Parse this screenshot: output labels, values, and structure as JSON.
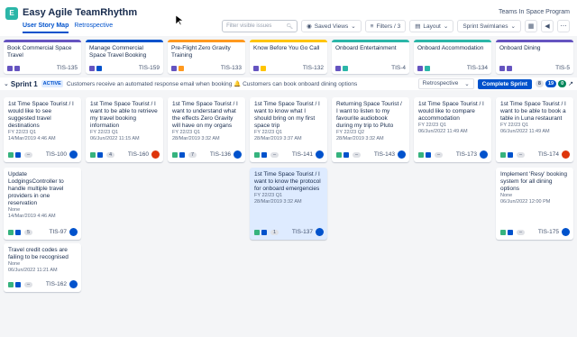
{
  "app": {
    "title": "Easy Agile TeamRhythm",
    "project": "Teams In Space Program"
  },
  "tabs": [
    {
      "label": "User Story Map"
    },
    {
      "label": "Retrospective"
    }
  ],
  "toolbar": {
    "search_placeholder": "Filter visible issues",
    "saved_views": "Saved Views",
    "filters": "Filters / 3",
    "layout": "Layout",
    "swimlanes": "Sprint Swimlanes"
  },
  "epics": [
    {
      "title": "Book Commercial Space Travel",
      "key": "TIS-135",
      "color": "#6554c0"
    },
    {
      "title": "Manage Commercial Space Travel Booking",
      "key": "TIS-159",
      "color": "#0052cc"
    },
    {
      "title": "Pre-Flight Zero Gravity Training",
      "key": "TIS-133",
      "color": "#ff991f"
    },
    {
      "title": "Know Before You Go Call",
      "key": "TIS-132",
      "color": "#ffc400"
    },
    {
      "title": "Onboard Entertainment",
      "key": "TIS-4",
      "color": "#2bb6a8"
    },
    {
      "title": "Onboard Accommodation",
      "key": "TIS-134",
      "color": "#2bb6a8"
    },
    {
      "title": "Onboard Dining",
      "key": "TIS-5",
      "color": "#6554c0"
    }
  ],
  "sprint": {
    "name": "Sprint 1",
    "badge": "ACTIVE",
    "goal": "Customers receive an automated response email when booking 🔔 Customers can book onboard dining options",
    "retro": "Retrospective",
    "complete": "Complete Sprint",
    "counts": [
      "8",
      "19",
      "0"
    ]
  },
  "cards": [
    {
      "col": 0,
      "row": 0,
      "title": "1st Time Space Tourist / I would like to see suggested travel destinations",
      "meta1": "FY 22/23 Q1",
      "meta2": "14/Mar/2019 4:46 AM",
      "est": "",
      "key": "TIS-100",
      "avatar": "blue"
    },
    {
      "col": 1,
      "row": 0,
      "title": "1st Time Space Tourist / I want to be able to retrieve my travel booking information",
      "meta1": "FY 22/23 Q1",
      "meta2": "06/Jun/2022 11:15 AM",
      "est": "4",
      "key": "TIS-160",
      "avatar": "red"
    },
    {
      "col": 2,
      "row": 0,
      "title": "1st Time Space Tourist / I want to understand what the effects Zero Gravity will have on my organs",
      "meta1": "FY 22/23 Q1",
      "meta2": "28/Mar/2019 3:32 AM",
      "est": "7",
      "key": "TIS-136",
      "avatar": "blue"
    },
    {
      "col": 3,
      "row": 0,
      "title": "1st Time Space Tourist / I want to know what I should bring on my first space trip",
      "meta1": "FY 22/23 Q1",
      "meta2": "28/Mar/2019 3:37 AM",
      "est": "",
      "key": "TIS-141",
      "avatar": "blue"
    },
    {
      "col": 4,
      "row": 0,
      "title": "Returning Space Tourist / I want to listen to my favourite audiobook during my trip to Pluto",
      "meta1": "FY 22/23 Q2",
      "meta2": "28/Mar/2019 3:32 AM",
      "est": "",
      "key": "TIS-143",
      "avatar": "blue"
    },
    {
      "col": 5,
      "row": 0,
      "title": "1st Time Space Tourist / I would like to compare accommodation",
      "meta1": "FY 22/23 Q1",
      "meta2": "06/Jun/2022 11:49 AM",
      "est": "",
      "key": "TIS-173",
      "avatar": "blue"
    },
    {
      "col": 6,
      "row": 0,
      "title": "1st Time Space Tourist / I want to be able to book a table in Luna restaurant",
      "meta1": "FY 22/23 Q1",
      "meta2": "06/Jun/2022 11:49 AM",
      "est": "",
      "key": "TIS-174",
      "avatar": "red"
    },
    {
      "col": 0,
      "row": 1,
      "title": "Update LodgingsController to handle multiple travel providers in one reservation",
      "meta1": "None",
      "meta2": "14/Mar/2019 4:46 AM",
      "est": "5",
      "key": "TIS-97",
      "avatar": "blue"
    },
    {
      "col": 3,
      "row": 1,
      "title": "1st Time Space Tourist / I want to know the protocol for onboard emergencies",
      "meta1": "FY 22/23 Q1",
      "meta2": "28/Mar/2019 3:32 AM",
      "est": "1",
      "key": "TIS-137",
      "avatar": "blue",
      "selected": true
    },
    {
      "col": 6,
      "row": 1,
      "title": "Implement 'Resy' booking system for all dining options",
      "meta1": "None",
      "meta2": "06/Jun/2022 12:00 PM",
      "est": "",
      "key": "TIS-175",
      "avatar": "blue"
    },
    {
      "col": 0,
      "row": 2,
      "title": "Travel credit codes are failing to be recognised",
      "meta1": "None",
      "meta2": "06/Jun/2022 11:21 AM",
      "est": "",
      "key": "TIS-162",
      "avatar": "blue"
    }
  ]
}
